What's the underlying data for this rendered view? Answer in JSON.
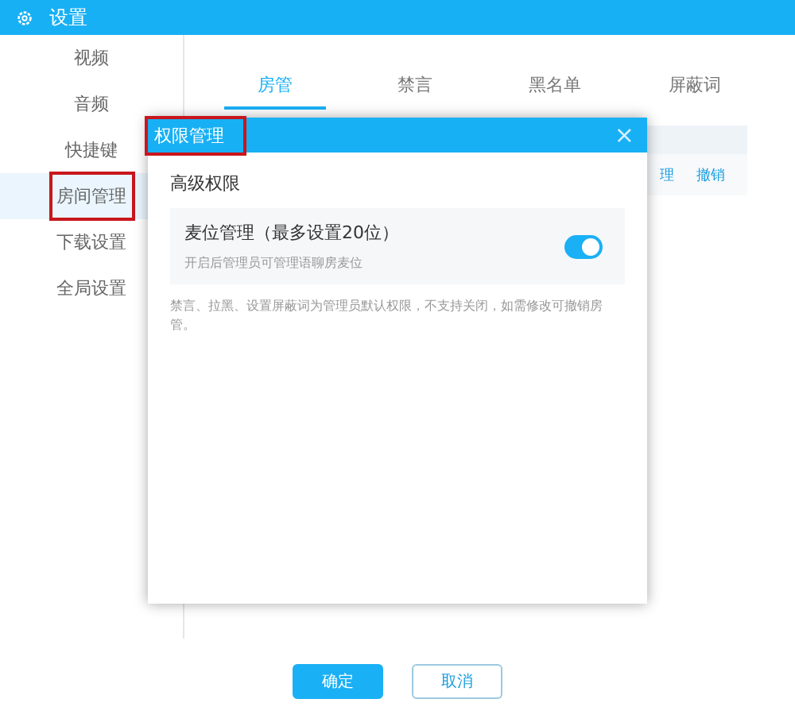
{
  "window": {
    "title": "设置"
  },
  "sidebar": {
    "items": [
      {
        "label": "视频",
        "selected": false,
        "highlighted": false
      },
      {
        "label": "音频",
        "selected": false,
        "highlighted": false
      },
      {
        "label": "快捷键",
        "selected": false,
        "highlighted": false
      },
      {
        "label": "房间管理",
        "selected": true,
        "highlighted": true
      },
      {
        "label": "下载设置",
        "selected": false,
        "highlighted": false
      },
      {
        "label": "全局设置",
        "selected": false,
        "highlighted": false
      }
    ]
  },
  "tabs": [
    {
      "label": "房管",
      "selected": true
    },
    {
      "label": "禁言",
      "selected": false
    },
    {
      "label": "黑名单",
      "selected": false
    },
    {
      "label": "屏蔽词",
      "selected": false
    }
  ],
  "table": {
    "row_actions": [
      "理",
      "撤销"
    ]
  },
  "dialog": {
    "title": "权限管理",
    "title_highlighted": true,
    "close": "×",
    "section": "高级权限",
    "option": {
      "title": "麦位管理（最多设置20位）",
      "description": "开启后管理员可管理语聊房麦位",
      "on": true
    },
    "note": "禁言、拉黑、设置屏蔽词为管理员默认权限，不支持关闭，如需修改可撤销房管。"
  },
  "buttons": [
    {
      "label": "确定",
      "kind": "primary"
    },
    {
      "label": "取消",
      "kind": "secondary"
    }
  ]
}
